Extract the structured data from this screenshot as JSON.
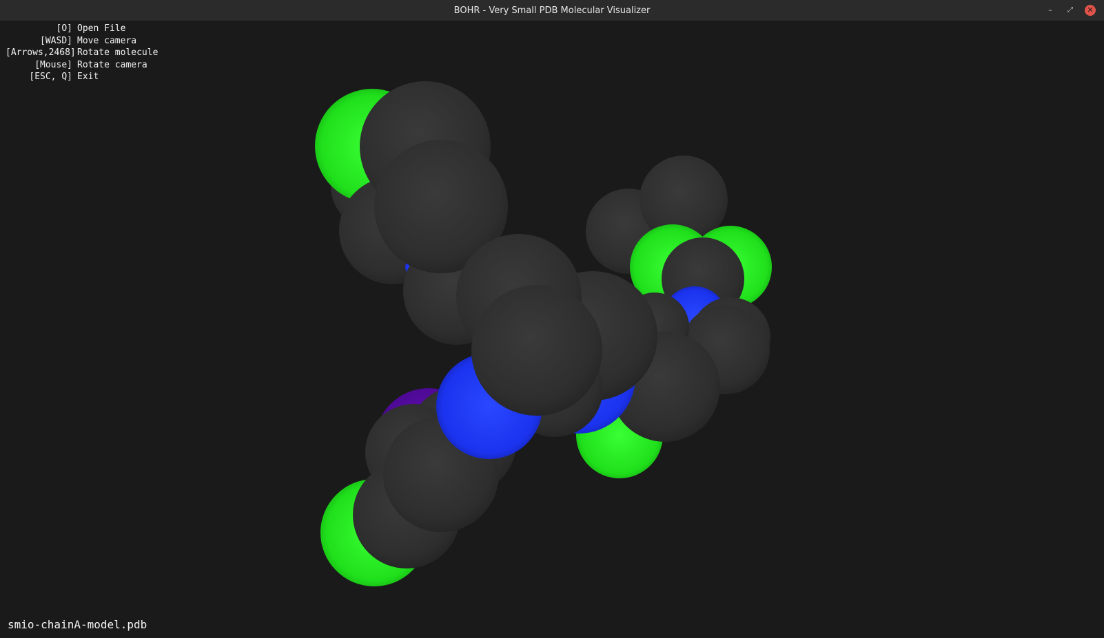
{
  "window": {
    "title": "BOHR - Very Small PDB Molecular Visualizer",
    "controls": [
      "minimize-icon",
      "restore-icon",
      "close-icon"
    ]
  },
  "help": [
    {
      "key": "[O]",
      "desc": "Open File"
    },
    {
      "key": "[WASD]",
      "desc": "Move camera"
    },
    {
      "key": "[Arrows,2468]",
      "desc": "Rotate molecule"
    },
    {
      "key": "[Mouse]",
      "desc": "Rotate camera"
    },
    {
      "key": "[ESC, Q]",
      "desc": "Exit"
    }
  ],
  "file": {
    "name": "smio-chainA-model.pdb"
  },
  "atom_colors": {
    "carbon": "#2f2f2f",
    "chlorine": "#22e21e",
    "nitrogen": "#1c33f0",
    "iodine": "#5c0aa8"
  }
}
